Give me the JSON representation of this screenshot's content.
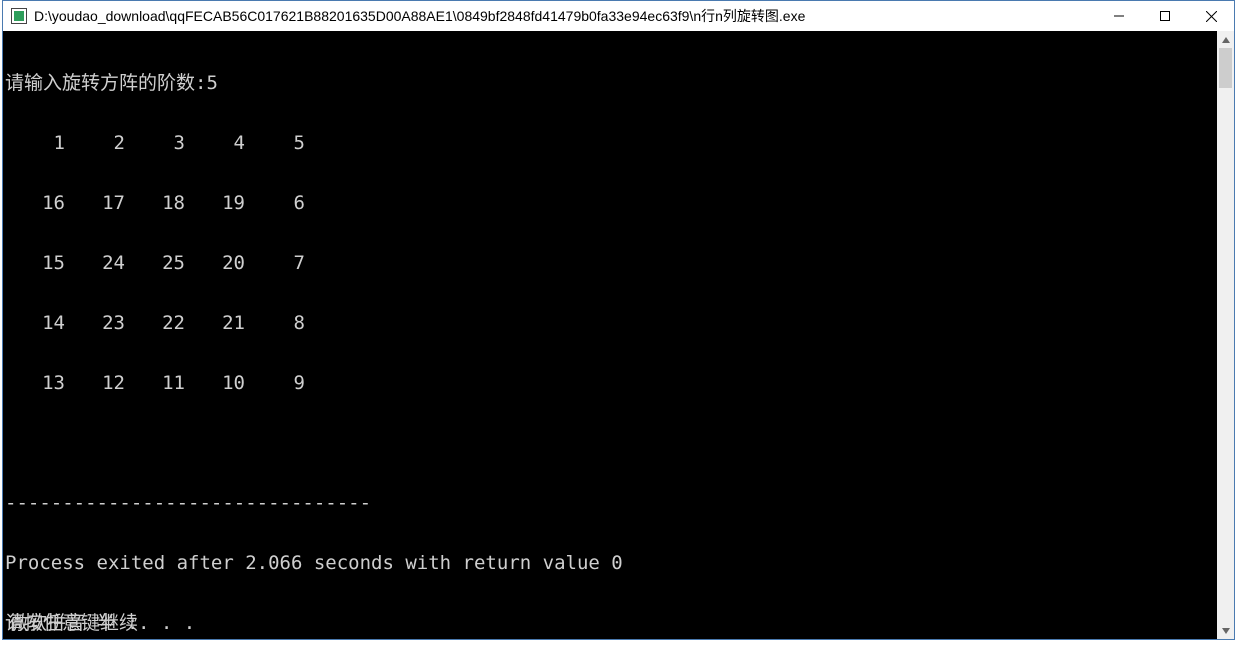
{
  "titlebar": {
    "title": "D:\\youdao_download\\qqFECAB56C017621B88201635D00A88AE1\\0849bf2848fd41479b0fa33e94ec63f9\\n行n列旋转图.exe"
  },
  "console": {
    "prompt_line": "请输入旋转方阵的阶数:5",
    "matrix": [
      [
        "1",
        "2",
        "3",
        "4",
        "5"
      ],
      [
        "16",
        "17",
        "18",
        "19",
        "6"
      ],
      [
        "15",
        "24",
        "25",
        "20",
        "7"
      ],
      [
        "14",
        "23",
        "22",
        "21",
        "8"
      ],
      [
        "13",
        "12",
        "11",
        "10",
        "9"
      ]
    ],
    "blank": "",
    "divider": "--------------------------------",
    "exit_line": "Process exited after 2.066 seconds with return value 0",
    "press_key": "请按任意键继续. . ."
  },
  "ime": {
    "text": "微软拼音 半 :"
  },
  "win_controls": {
    "minimize": "minimize",
    "maximize": "maximize",
    "close": "close"
  }
}
